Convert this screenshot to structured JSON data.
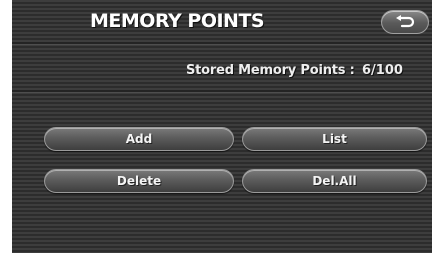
{
  "header": {
    "title": "MEMORY POINTS",
    "back_icon": "return-arrow-icon"
  },
  "stored": {
    "label": "Stored Memory Points :",
    "value": "6/100"
  },
  "actions": {
    "add_label": "Add",
    "list_label": "List",
    "delete_label": "Delete",
    "delete_all_label": "Del.All"
  }
}
